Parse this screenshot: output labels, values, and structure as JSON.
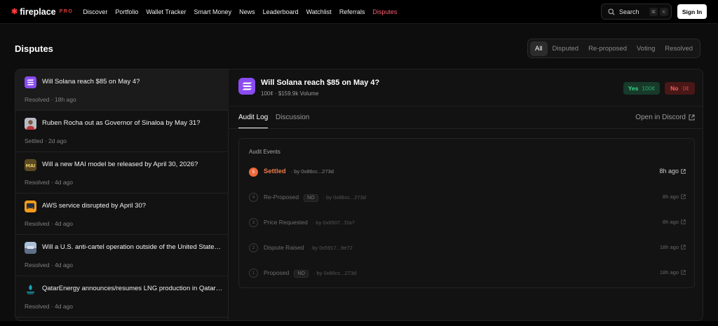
{
  "nav": {
    "logo": "fireplace",
    "logo_badge": "PRO",
    "links": [
      "Discover",
      "Portfolio",
      "Wallet Tracker",
      "Smart Money",
      "News",
      "Leaderboard",
      "Watchlist",
      "Referrals",
      "Disputes"
    ],
    "active_link": "Disputes",
    "search_label": "Search",
    "search_kbd": [
      "⌘",
      "K"
    ],
    "signin_label": "Sign In"
  },
  "page": {
    "title": "Disputes",
    "filters": [
      "All",
      "Disputed",
      "Re-proposed",
      "Voting",
      "Resolved"
    ],
    "active_filter": "All"
  },
  "disputes": [
    {
      "title": "Will Solana reach $85 on May 4?",
      "status": "Resolved",
      "age": "18h ago",
      "icon": "solana-icon"
    },
    {
      "title": "Ruben Rocha out as Governor of Sinaloa by May 31?",
      "status": "Settled",
      "age": "2d ago",
      "icon": "portrait-icon"
    },
    {
      "title": "Will a new MAI model be released by April 30, 2026?",
      "status": "Resolved",
      "age": "4d ago",
      "icon": "mai-icon"
    },
    {
      "title": "AWS service disrupted by April 30?",
      "status": "Resolved",
      "age": "4d ago",
      "icon": "aws-icon"
    },
    {
      "title": "Will a U.S. anti-cartel operation outside of the United States...",
      "status": "Resolved",
      "age": "4d ago",
      "icon": "photo-icon"
    },
    {
      "title": "QatarEnergy announces/resumes LNG production in Qatar ...",
      "status": "Resolved",
      "age": "4d ago",
      "icon": "qatarenergy-icon"
    }
  ],
  "detail": {
    "title": "Will Solana reach $85 on May 4?",
    "subtitle": "100¢ · $159.9k Volume",
    "yes_label": "Yes",
    "yes_price": "100¢",
    "no_label": "No",
    "no_price": "0¢",
    "tabs": [
      "Audit Log",
      "Discussion"
    ],
    "active_tab": "Audit Log",
    "discord_link": "Open in Discord",
    "audit_title": "Audit Events",
    "events": [
      {
        "num": "5",
        "label": "Settled",
        "badge": "",
        "by": "· by 0x86cc...273d",
        "time": "8h ago"
      },
      {
        "num": "4",
        "label": "Re-Proposed",
        "badge": "NO",
        "by": "· by 0x86cc...273d",
        "time": "8h ago"
      },
      {
        "num": "3",
        "label": "Price Requested",
        "badge": "",
        "by": "· by 0x6507...f2a7",
        "time": "8h ago"
      },
      {
        "num": "2",
        "label": "Dispute Raised",
        "badge": "",
        "by": "· by 0x5917...9e72",
        "time": "18h ago"
      },
      {
        "num": "1",
        "label": "Proposed",
        "badge": "NO",
        "by": "· by 0x86cc...273d",
        "time": "18h ago"
      }
    ]
  },
  "colors": {
    "accent": "#ff5b6e",
    "settled_orange": "#f06a3a",
    "yes_green": "#3fd58a",
    "no_red": "#ff5b5b",
    "solana_purple": "#8a4bf0"
  }
}
